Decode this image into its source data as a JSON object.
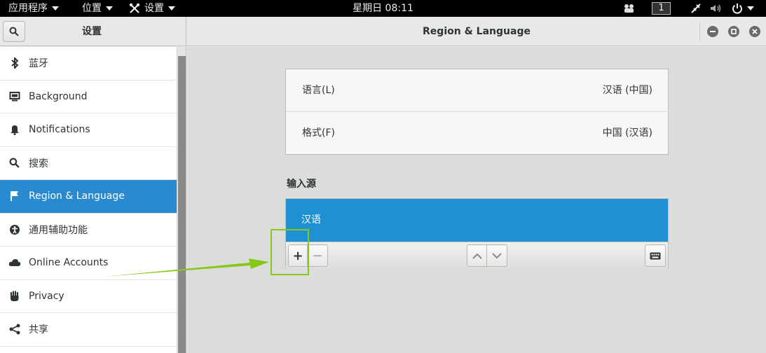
{
  "topbar": {
    "applications": "应用程序",
    "places": "位置",
    "settings_menu": "设置",
    "clock": "星期日 08:11",
    "workspace": "1"
  },
  "sidebar": {
    "title": "设置",
    "items": [
      {
        "label": "蓝牙",
        "icon": "bluetooth-icon"
      },
      {
        "label": "Background",
        "icon": "monitor-icon"
      },
      {
        "label": "Notifications",
        "icon": "bell-icon"
      },
      {
        "label": "搜索",
        "icon": "search-icon"
      },
      {
        "label": "Region & Language",
        "icon": "flag-icon",
        "active": true
      },
      {
        "label": "通用辅助功能",
        "icon": "accessibility-icon"
      },
      {
        "label": "Online Accounts",
        "icon": "cloud-icon"
      },
      {
        "label": "Privacy",
        "icon": "hand-icon"
      },
      {
        "label": "共享",
        "icon": "share-icon"
      }
    ]
  },
  "main": {
    "title": "Region & Language",
    "language_label": "语言(L)",
    "language_value": "汉语 (中国)",
    "formats_label": "格式(F)",
    "formats_value": "中国 (汉语)",
    "input_sources_title": "输入源",
    "input_sources": [
      "汉语"
    ],
    "add_button": "+",
    "remove_button": "−"
  },
  "colors": {
    "accent": "#2a8ad0",
    "selected_row": "#1f90d2",
    "annotation": "#86c81a",
    "topbar": "#000000"
  }
}
